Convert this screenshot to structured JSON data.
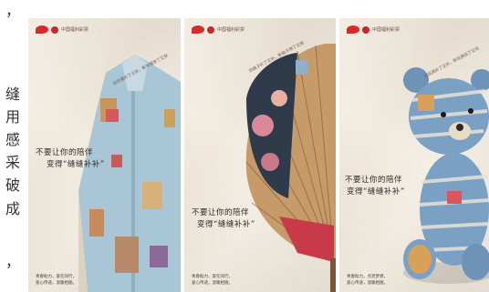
{
  "article_fragment": [
    " ，",
    "缝",
    "用",
    "感",
    "采",
    "破",
    "成",
    "，"
  ],
  "posters": [
    {
      "id": "jacket",
      "logo_text": "中国福利彩票",
      "diag_text": "旧衣服补了又补，新衣服穿了又穿",
      "slogan_line1": "不要让你的陪伴",
      "slogan_line2": "变得“缝缝补补”",
      "footer_line1": "青春助力，爱在同行，",
      "footer_line2": "爱心传递，温暖相随。"
    },
    {
      "id": "fan",
      "logo_text": "中国福利彩票",
      "diag_text": "旧扇子补了又补，新扇子用了又用",
      "slogan_line1": "不要让你的陪伴",
      "slogan_line2": "变得“缝缝补补”",
      "footer_line1": "青春助力，爱在同行，",
      "footer_line2": "爱心传递，温暖相随。"
    },
    {
      "id": "bear",
      "logo_text": "中国福利彩票",
      "diag_text": "旧玩具补了又补，新玩具玩了又玩",
      "slogan_line1": "不要让你的陪伴",
      "slogan_line2": "变得“缝缝补补”",
      "footer_line1": "青春助力，点亮梦想，",
      "footer_line2": "爱心传递，温暖相随。"
    }
  ],
  "colors": {
    "paper": "#eee5d6",
    "logo_red": "#d62b2b",
    "slogan_ink": "#2c2b2b",
    "denim": "#9fbfd0",
    "fan_bamboo": "#b8875a",
    "bear_blue": "#5f86b0"
  }
}
